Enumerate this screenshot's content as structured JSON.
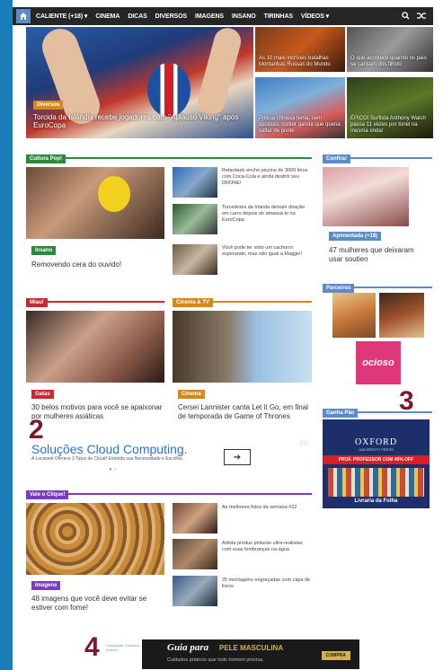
{
  "nav": {
    "items": [
      "CALIENTE (+18) ▾",
      "CINEMA",
      "DICAS",
      "DIVERSOS",
      "IMAGENS",
      "INSANO",
      "TIRINHAS",
      "VÍDEOS ▾"
    ],
    "search_icon": "search-icon",
    "shuffle_icon": "shuffle-icon"
  },
  "hero": {
    "tag": "Diversos",
    "caption": "Torcida da Islândia recebe jogadores com \"Aplauso Viking\" após EuroCopa"
  },
  "thumbs": [
    "As 10 mais incríveis batalhas Montanhas Russas do Mundo",
    "O que acontece quando os pais se cansam dos filhos!",
    "Polícia chinesa tenta, sem sucesso, conter garota que queria saltar de ponte",
    "ÉPICO! Surfista Anthony Walsh passa 11 vezes por túnel na mesma onda!"
  ],
  "sections": {
    "cultura_pop": {
      "title": "Cultura Pop!",
      "main_badge": "Insano",
      "main_caption": "Removendo cera do ouvido!",
      "items": [
        "Retardado enche piscina de 3000 litros com Coca-Cola e ainda destrói seu DRONE!",
        "Torcedores da Irlanda deixam doação em carro depois de amassá-lo na EuroCopa",
        "Você pode ter visto um cachorro esperando, mas não igual a Maggie!"
      ]
    },
    "confira": {
      "title": "Confira!",
      "badge": "Apimentada (+18)",
      "caption": "47 mulheres que deixaram usar soutien"
    },
    "miau": {
      "title": "Miau!",
      "badge": "Gatas",
      "caption": "30 belos motivos para você se apaixonar por mulheres asiáticas"
    },
    "cinema": {
      "title": "Cinema & TV",
      "badge": "Cinema",
      "caption": "Cersei Lannister canta Let it Go, em final de temporada de Game of Thrones"
    },
    "parceiros": {
      "title": "Parceiros",
      "partner_label": "ocioso"
    },
    "ganha": {
      "title": "Ganha Pão"
    },
    "vale": {
      "title": "Vale o Clique!",
      "main_badge": "Imagens",
      "main_caption": "48 imagens que você deve evitar se estiver com fome!",
      "items": [
        "As melhores fotos da semana #22",
        "Artista produz pinturas ultra-realistas com suas lembranças na água",
        "25 montagens engraçadas com capa de livros"
      ]
    }
  },
  "ad": {
    "title": "Soluções Cloud Computing.",
    "subtitle": "A Locaweb Oferece 3 Tipos de Cloud! Entenda sua Necessidade e Escolha.",
    "button": "➔",
    "dots": "● ○",
    "info": "ⓘ▷"
  },
  "oxford": {
    "brand": "OXFORD",
    "brand_sub": "UNIVERSITY PRESS",
    "promo": "PROF. PROFESSOR COM 40% OFF",
    "footer": "Livraria da Folha"
  },
  "bottom_ad": {
    "title": "Guia para",
    "title2": "PELE MASCULINA",
    "sub": "Cuidados práticos que todo homem precisa.",
    "buy": "COMPRA",
    "side": "Hidratação Cuidados Diários"
  },
  "annotations": [
    "2",
    "3",
    "4"
  ]
}
